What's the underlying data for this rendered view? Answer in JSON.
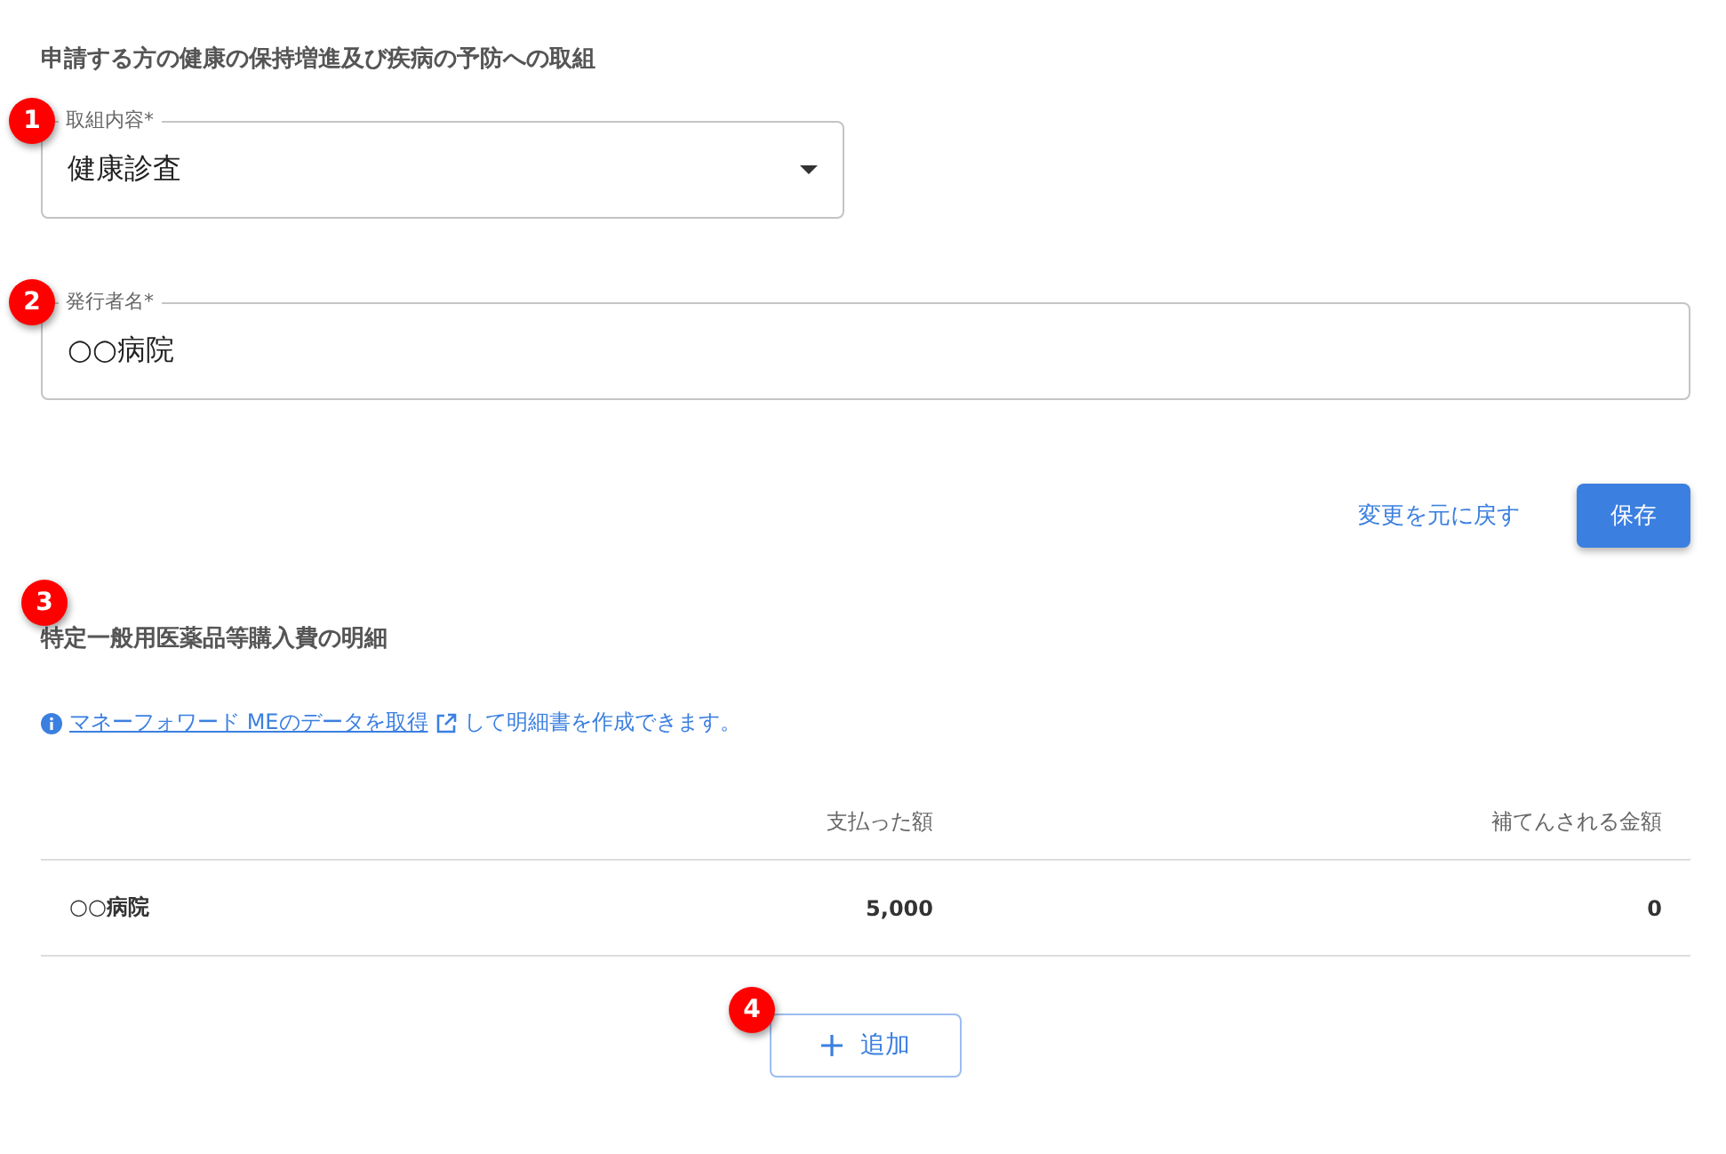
{
  "section1": {
    "title": "申請する方の健康の保持増進及び疾病の予防への取組",
    "fields": [
      {
        "kind": "select",
        "label": "取組内容*",
        "value": "健康診査",
        "marker": "1"
      },
      {
        "kind": "text",
        "label": "発行者名*",
        "value": "○○病院",
        "marker": "2"
      }
    ],
    "actions": {
      "revert": "変更を元に戻す",
      "save": "保存"
    }
  },
  "section2": {
    "marker": "3",
    "title": "特定一般用医薬品等購入費の明細",
    "info": {
      "link": "マネーフォワード MEのデータを取得",
      "text": "して明細書を作成できます。"
    },
    "table": {
      "columns": [
        "支払った額",
        "補てんされる金額"
      ],
      "rows": [
        {
          "name": "○○病院",
          "cells": [
            "5,000",
            "0"
          ]
        }
      ]
    },
    "add": {
      "label": "追加",
      "marker": "4"
    }
  }
}
